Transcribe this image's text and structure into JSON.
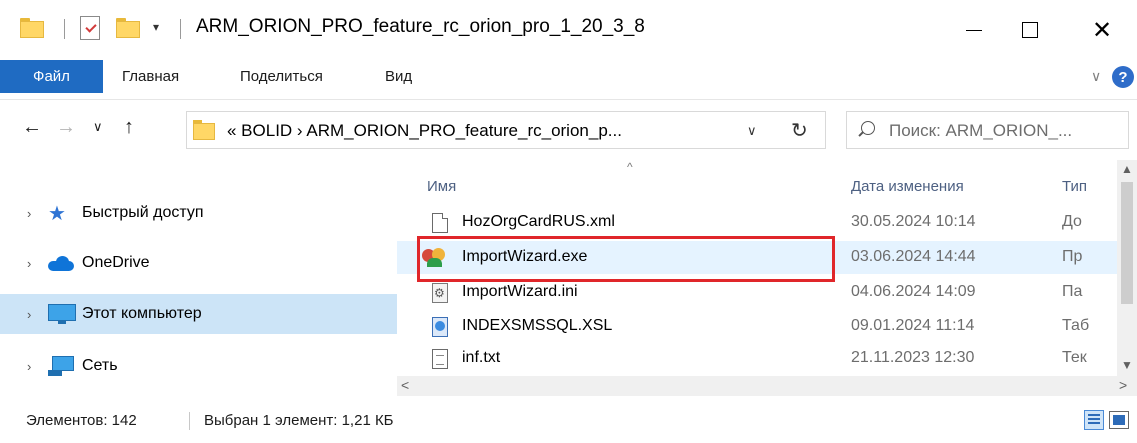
{
  "window": {
    "title": "ARM_ORION_PRO_feature_rc_orion_pro_1_20_3_8",
    "qa_dropdown_glyph": "▾",
    "minimize_glyph": "—",
    "close_glyph": "✕"
  },
  "ribbon": {
    "tabs": [
      "Файл",
      "Главная",
      "Поделиться",
      "Вид"
    ],
    "expand_glyph": "∨",
    "help_glyph": "?"
  },
  "address": {
    "back_glyph": "←",
    "forward_glyph": "→",
    "recent_glyph": "∨",
    "up_glyph": "↑",
    "path": "« BOLID › ARM_ORION_PRO_feature_rc_orion_p...",
    "dropdown_glyph": "∨",
    "refresh_glyph": "↻",
    "search_placeholder": "Поиск: ARM_ORION_..."
  },
  "navpane": {
    "items": [
      {
        "label": "Быстрый доступ",
        "icon": "star-icon"
      },
      {
        "label": "OneDrive",
        "icon": "cloud-icon"
      },
      {
        "label": "Этот компьютер",
        "icon": "computer-icon",
        "selected": true
      },
      {
        "label": "Сеть",
        "icon": "network-icon"
      }
    ],
    "chevron": "›"
  },
  "filelist": {
    "sort_caret": "^",
    "columns": {
      "name": "Имя",
      "date": "Дата изменения",
      "type": "Тип"
    },
    "rows": [
      {
        "name": "HozOrgCardRUS.xml",
        "date": "30.05.2024 10:14",
        "type": "До",
        "icon": "document-icon"
      },
      {
        "name": "ImportWizard.exe",
        "date": "03.06.2024 14:44",
        "type": "Пр",
        "icon": "people-app-icon",
        "selected": true
      },
      {
        "name": "ImportWizard.ini",
        "date": "04.06.2024 14:09",
        "type": "Па",
        "icon": "settings-file-icon"
      },
      {
        "name": "INDEXSMSSQL.XSL",
        "date": "09.01.2024 11:14",
        "type": "Таб",
        "icon": "xsl-file-icon"
      },
      {
        "name": "inf.txt",
        "date": "21.11.2023 12:30",
        "type": "Тек",
        "icon": "text-file-icon"
      }
    ],
    "scroll": {
      "up": "▲",
      "down": "▼",
      "left": "<",
      "right": ">"
    },
    "highlight_color": "#e0262a"
  },
  "status": {
    "count": "Элементов: 142",
    "selection": "Выбран 1 элемент: 1,21 КБ"
  },
  "colors": {
    "file_tab": "#1f6bc2",
    "selected_nav": "#cce4f7",
    "selected_row": "#e5f3ff",
    "header_text": "#4d6082"
  }
}
